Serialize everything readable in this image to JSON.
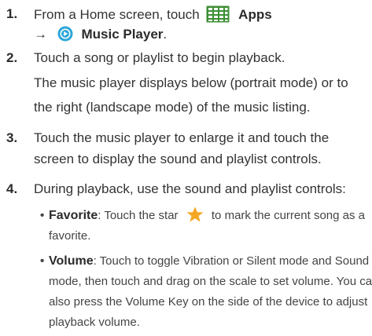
{
  "steps": [
    {
      "number": "1.",
      "line1_prefix": "From a Home screen, touch",
      "apps_label": "Apps",
      "arrow": "→",
      "music_player_label": "Music Player",
      "line2_suffix": "."
    },
    {
      "number": "2.",
      "line1": "Touch a song or playlist to begin playback.",
      "sub_line1": "The music player displays below (portrait mode) or to",
      "sub_line2": "the right (landscape mode) of the music listing."
    },
    {
      "number": "3.",
      "line1": "Touch the music player to enlarge it and touch the",
      "line2": "screen to display the sound and playlist controls."
    },
    {
      "number": "4.",
      "line1": "During playback, use the sound and playlist controls:"
    }
  ],
  "bullets": [
    {
      "label": "Favorite",
      "text_before_star": ": Touch the star",
      "text_after_star": "to mark the current song as a",
      "line2": "favorite."
    },
    {
      "label": "Volume",
      "line1": ": Touch to toggle Vibration or Silent mode and Sound",
      "line2": "mode, then touch and drag on the scale to set volume. You can",
      "line3": "also press the Volume Key on the side of the device to adjust",
      "line4": "playback volume."
    }
  ],
  "colors": {
    "apps_icon": "#3d8f35",
    "music_icon": "#2aa6d9",
    "star": "#f5a623"
  },
  "icons": [
    "apps-grid-icon",
    "music-player-icon",
    "star-icon"
  ]
}
